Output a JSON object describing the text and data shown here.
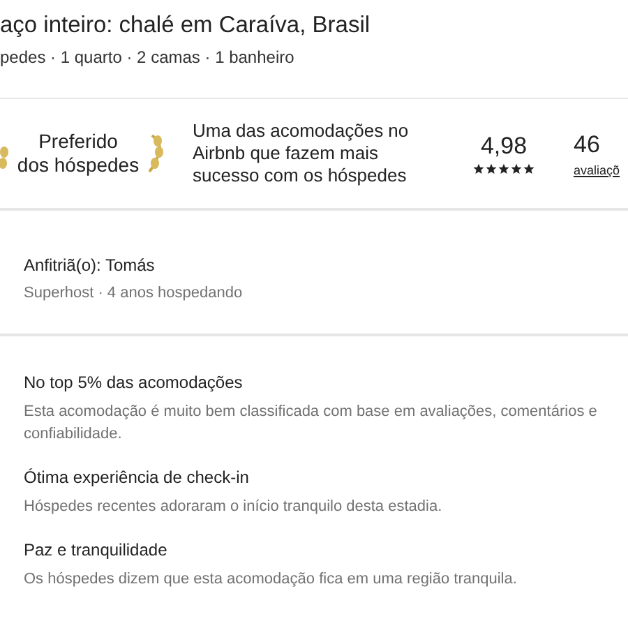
{
  "listing": {
    "title": "aço inteiro: chalé em Caraíva, Brasil",
    "details": "pedes · 1 quarto · 2 camas · 1 banheiro"
  },
  "badge": {
    "label_line1": "Preferido",
    "label_line2": "dos hóspedes",
    "description": "Uma das acomodações no Airbnb que fazem mais sucesso com os hóspedes",
    "rating": "4,98",
    "stars": 5,
    "reviews_count": "46",
    "reviews_label": "avaliaçõ"
  },
  "host": {
    "name": "Anfitriã(o): Tomás",
    "info": "Superhost · 4 anos hospedando"
  },
  "highlights": [
    {
      "title": "No top 5% das acomodações",
      "text": "Esta acomodação é muito bem classificada com base em avaliações, comentários e confiabilidade."
    },
    {
      "title": "Ótima experiência de check-in",
      "text": "Hóspedes recentes adoraram o início tranquilo desta estadia."
    },
    {
      "title": "Paz e tranquilidade",
      "text": "Os hóspedes dizem que esta acomodação fica em uma região tranquila."
    }
  ]
}
